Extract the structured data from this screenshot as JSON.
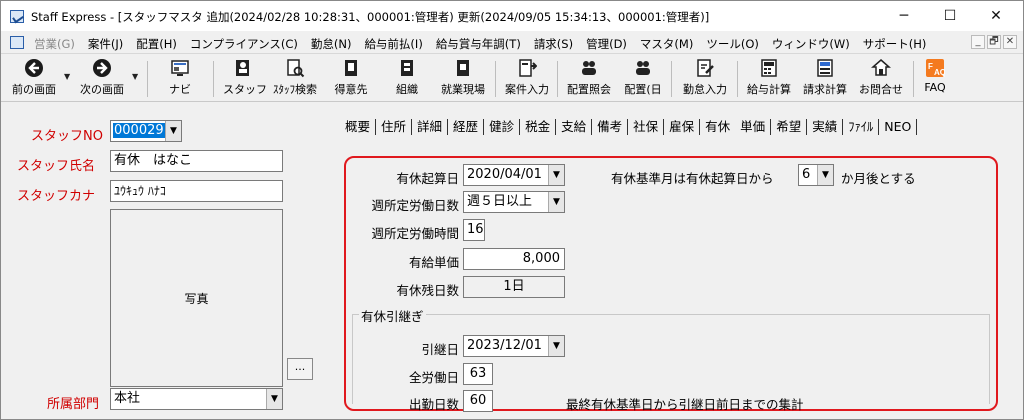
{
  "window": {
    "title": "Staff Express - [スタッフマスタ 追加(2024/02/28 10:28:31、000001:管理者) 更新(2024/09/05 15:34:13、000001:管理者)]",
    "minimize": "─",
    "maximize": "☐",
    "close": "✕"
  },
  "menubar": {
    "items": [
      "営業(G)",
      "案件(J)",
      "配置(H)",
      "コンプライアンス(C)",
      "勤怠(N)",
      "給与前払(I)",
      "給与賞与年調(T)",
      "請求(S)",
      "管理(D)",
      "マスタ(M)",
      "ツール(O)",
      "ウィンドウ(W)",
      "サポート(H)"
    ],
    "mdi_controls": [
      "_",
      "🗗",
      "✕"
    ]
  },
  "toolbar": {
    "back": "前の画面",
    "forward": "次の画面",
    "navi": "ナビ",
    "staff": "スタッフ",
    "staff_search": "ｽﾀｯﾌ検索",
    "client": "得意先",
    "organization": "組織",
    "site": "就業現場",
    "case_input": "案件入力",
    "assign_query": "配置照会",
    "assign_day": "配置(日",
    "attendance_input": "勤怠入力",
    "payroll": "給与計算",
    "billing": "請求計算",
    "inquiry": "お問合せ",
    "faq": "FAQ"
  },
  "staff": {
    "no_label": "スタッフNO",
    "no_value": "000029",
    "name_label": "スタッフ氏名",
    "name_value": "有休　はなこ",
    "kana_label": "スタッフカナ",
    "kana_value": "ﾕｳｷｭｳ ﾊﾅｺ",
    "photo_label": "写真",
    "browse_button": "...",
    "dept_label": "所属部門",
    "dept_value": "本社"
  },
  "tabs": [
    "概要",
    "住所",
    "詳細",
    "経歴",
    "健診",
    "税金",
    "支給",
    "備考",
    "社保",
    "雇保",
    "有休",
    "単価",
    "希望",
    "実績",
    "ﾌｧｲﾙ",
    "NEO"
  ],
  "active_tab": "有休",
  "leave": {
    "start_label": "有休起算日",
    "start_value": "2020/04/01",
    "base_month_prefix": "有休基準月は有休起算日から",
    "base_month_value": "6",
    "base_month_suffix": "か月後とする",
    "weekly_days_label": "週所定労働日数",
    "weekly_days_value": "週５日以上",
    "weekly_hours_label": "週所定労働時間",
    "weekly_hours_value": "16",
    "unit_price_label": "有給単価",
    "unit_price_value": "8,000",
    "remaining_label": "有休残日数",
    "remaining_value": "1日"
  },
  "carryover": {
    "group_title": "有休引継ぎ",
    "date_label": "引継日",
    "date_value": "2023/12/01",
    "total_days_label": "全労働日",
    "total_days_value": "63",
    "attendance_label": "出勤日数",
    "attendance_value": "60",
    "note": "最終有休基準日から引継日前日までの集計"
  },
  "colors": {
    "highlight_frame": "#e0191e",
    "required_label": "#d00000",
    "selection": "#0078d7"
  }
}
